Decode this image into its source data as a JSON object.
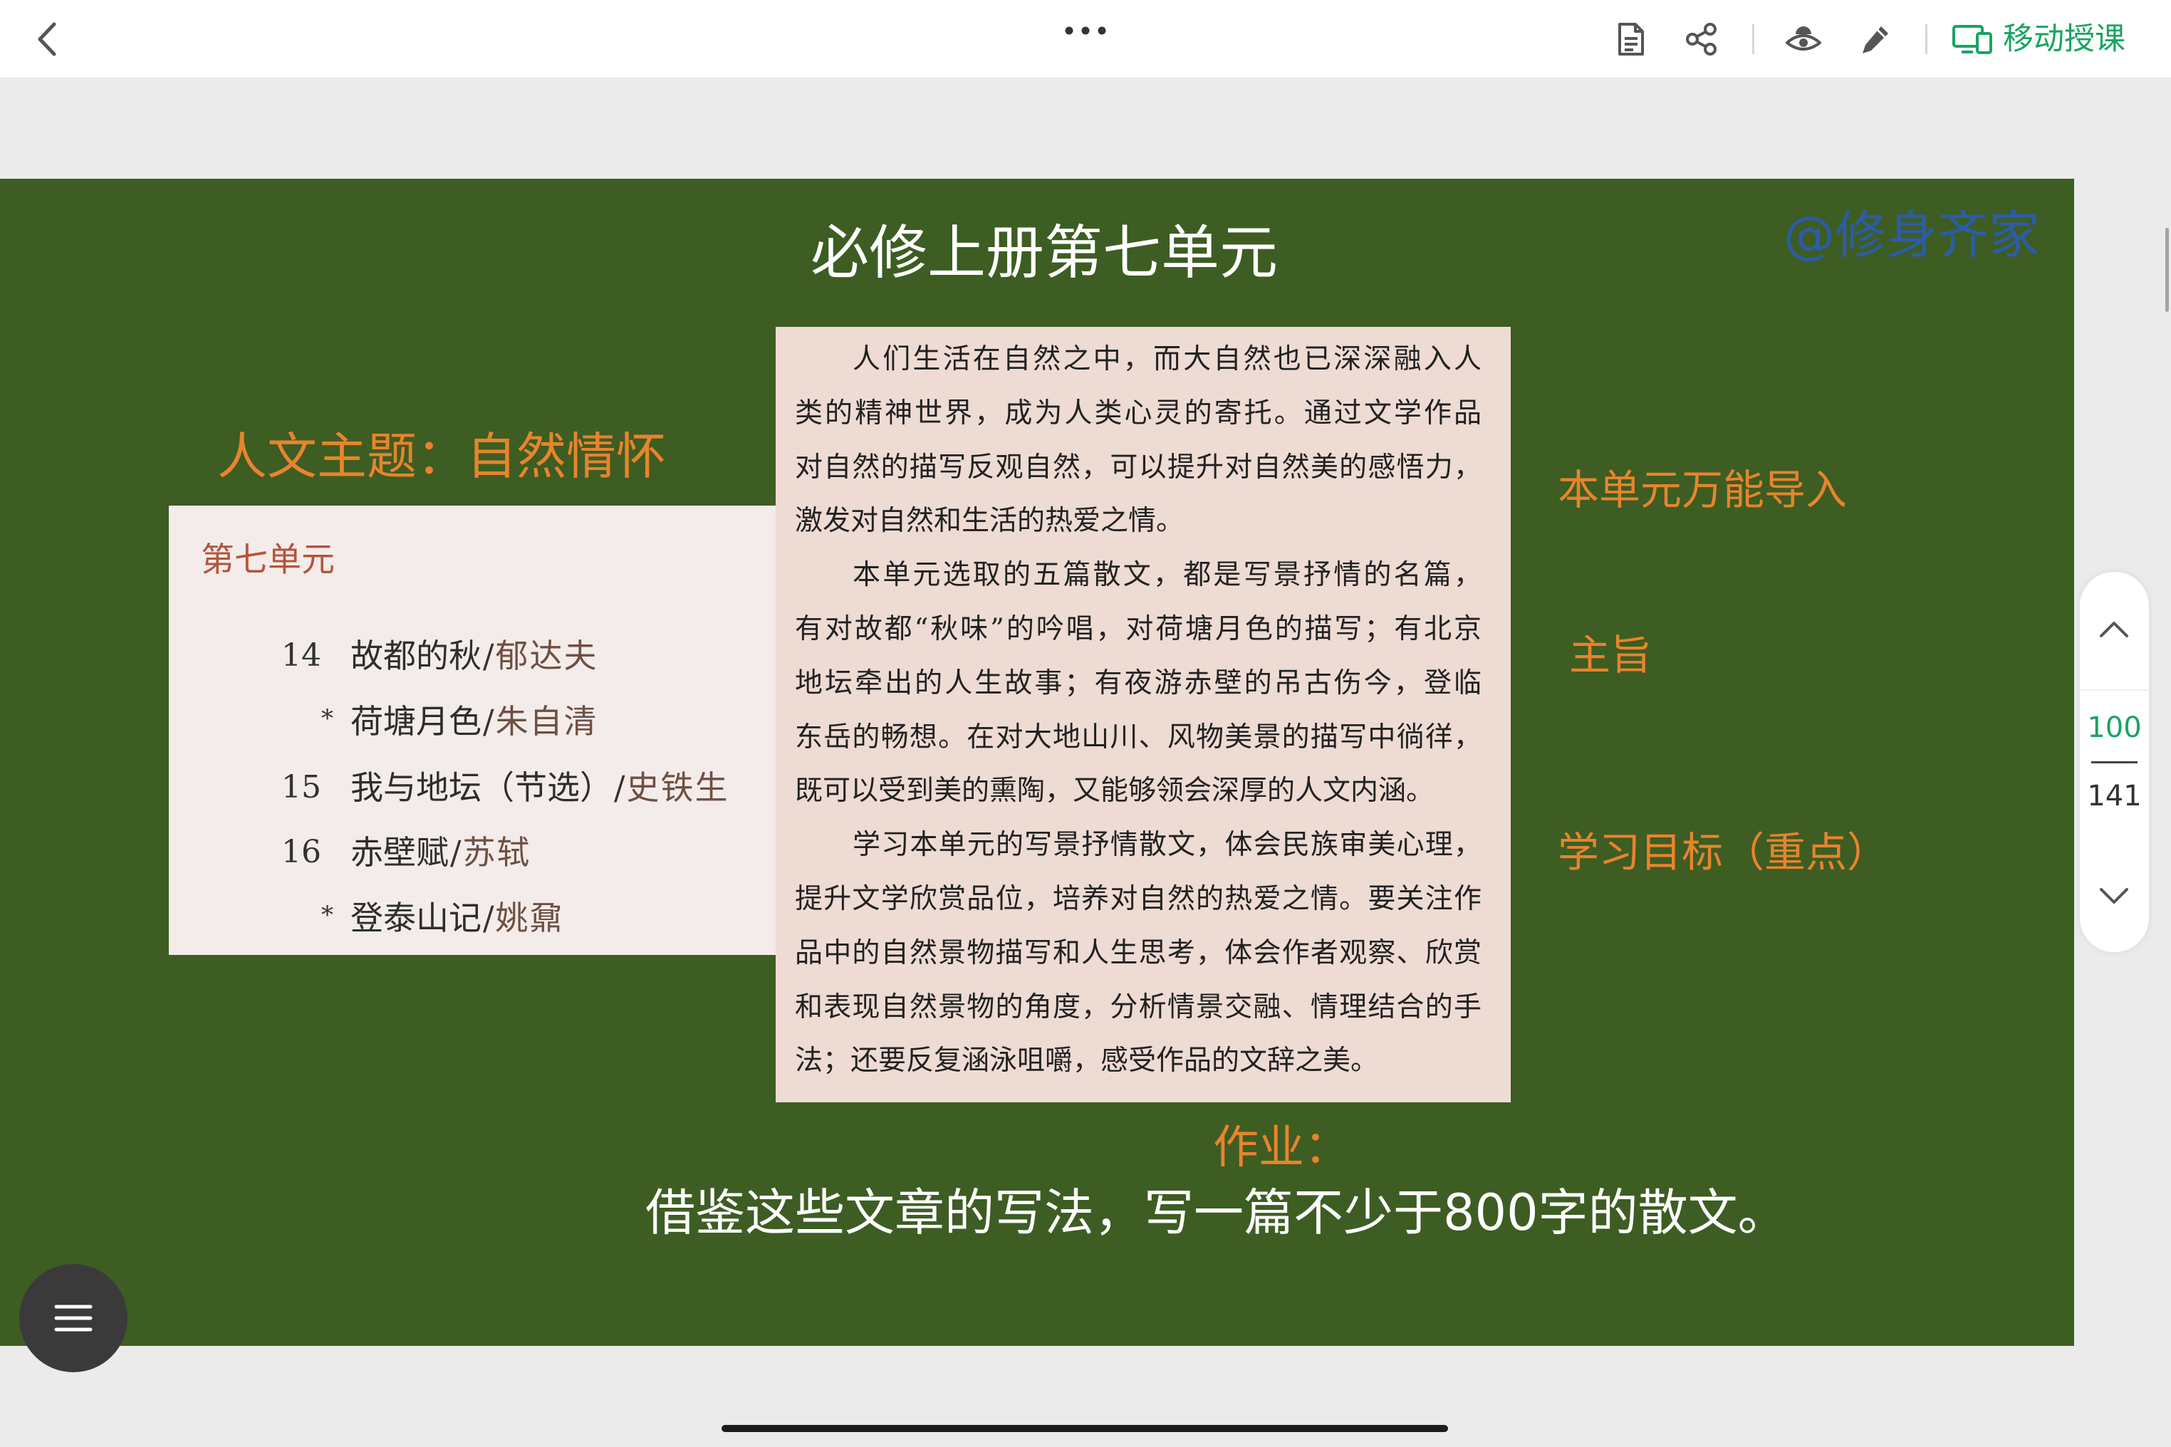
{
  "topbar": {
    "back_icon": "chevron-left-icon",
    "more_icon": "more-horizontal-icon",
    "notes_icon": "document-icon",
    "share_icon": "share-icon",
    "view_icon": "eye-icon",
    "annotate_icon": "pen-icon",
    "cast_icon": "screen-cast-icon",
    "mobile_teach_label": "移动授课"
  },
  "slide": {
    "title": "必修上册第七单元",
    "watermark": "@修身齐家",
    "theme": "人文主题：自然情怀",
    "unit_panel": {
      "heading": "第七单元",
      "separator": "/",
      "items": [
        {
          "number": "14",
          "title": "故都的秋",
          "author": "郁达夫"
        },
        {
          "marker": "*",
          "title": "荷塘月色",
          "author": "朱自清"
        },
        {
          "number": "15",
          "title": "我与地坛（节选）",
          "author": "史铁生"
        },
        {
          "number": "16",
          "title": "赤壁赋",
          "author": "苏轼"
        },
        {
          "marker": "*",
          "title": "登泰山记",
          "author": "姚鼐"
        }
      ]
    },
    "intro_text": {
      "lines": [
        "人们生活在自然之中，而大自然也已深深融入人",
        "类的精神世界，成为人类心灵的寄托。通过文学作品",
        "对自然的描写反观自然，可以提升对自然美的感悟力，",
        "激发对自然和生活的热爱之情。",
        "本单元选取的五篇散文，都是写景抒情的名篇，",
        "有对故都“秋味”的吟唱，对荷塘月色的描写；有北京",
        "地坛牵出的人生故事；有夜游赤壁的吊古伤今，登临",
        "东岳的畅想。在对大地山川、风物美景的描写中徜徉，",
        "既可以受到美的熏陶，又能够领会深厚的人文内涵。",
        "学习本单元的写景抒情散文，体会民族审美心理，",
        "提升文学欣赏品位，培养对自然的热爱之情。要关注作",
        "品中的自然景物描写和人生思考，体会作者观察、欣赏",
        "和表现自然景物的角度，分析情景交融、情理结合的手",
        "法；还要反复涵泳咀嚼，感受作品的文辞之美。"
      ]
    },
    "side_labels": {
      "intro": "本单元万能导入",
      "theme": "主旨",
      "goals": "学习目标（重点）"
    },
    "homework": {
      "label": "作业：",
      "text": "借鉴这些文章的写法，写一篇不少于800字的散文。"
    }
  },
  "pager": {
    "prev_icon": "chevron-up-icon",
    "current_page": "100",
    "total_pages": "141",
    "next_icon": "chevron-down-icon"
  },
  "menu_button": {
    "icon": "hamburger-menu-icon"
  },
  "colors": {
    "page-bg": "#ebebeb",
    "slide-bg": "#3d5d23",
    "orange": "#e8842c",
    "watermark": "#2c5ca8",
    "green": "#19a463",
    "panel-left": "#f4ecea",
    "panel-center": "#eedbd4",
    "heading-red": "#b4553b"
  }
}
